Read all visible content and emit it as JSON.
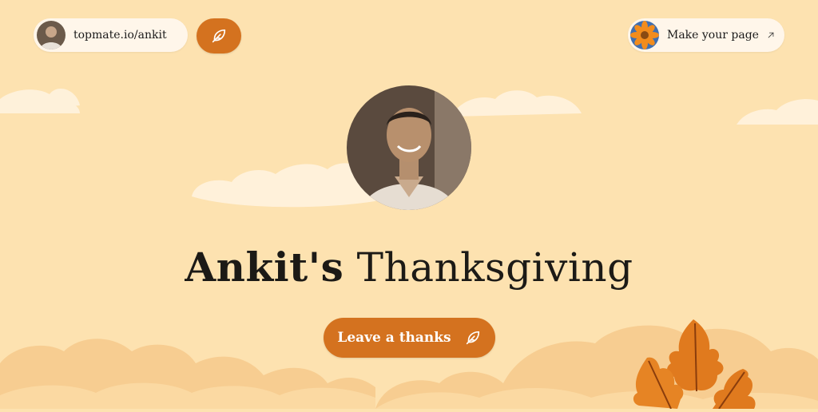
{
  "header": {
    "profile_link": "topmate.io/ankit",
    "make_page_label": "Make your page"
  },
  "hero": {
    "name": "Ankit's",
    "title_rest": "Thanksgiving"
  },
  "cta": {
    "label": "Leave a thanks"
  },
  "colors": {
    "background": "#fde2b0",
    "accent": "#d4721f",
    "pill_bg": "#fff6ea",
    "cloud": "#fff3df",
    "leaf": "#e07a1e"
  },
  "icons": {
    "feather": "feather-icon",
    "arrow": "arrow-up-right-icon"
  }
}
